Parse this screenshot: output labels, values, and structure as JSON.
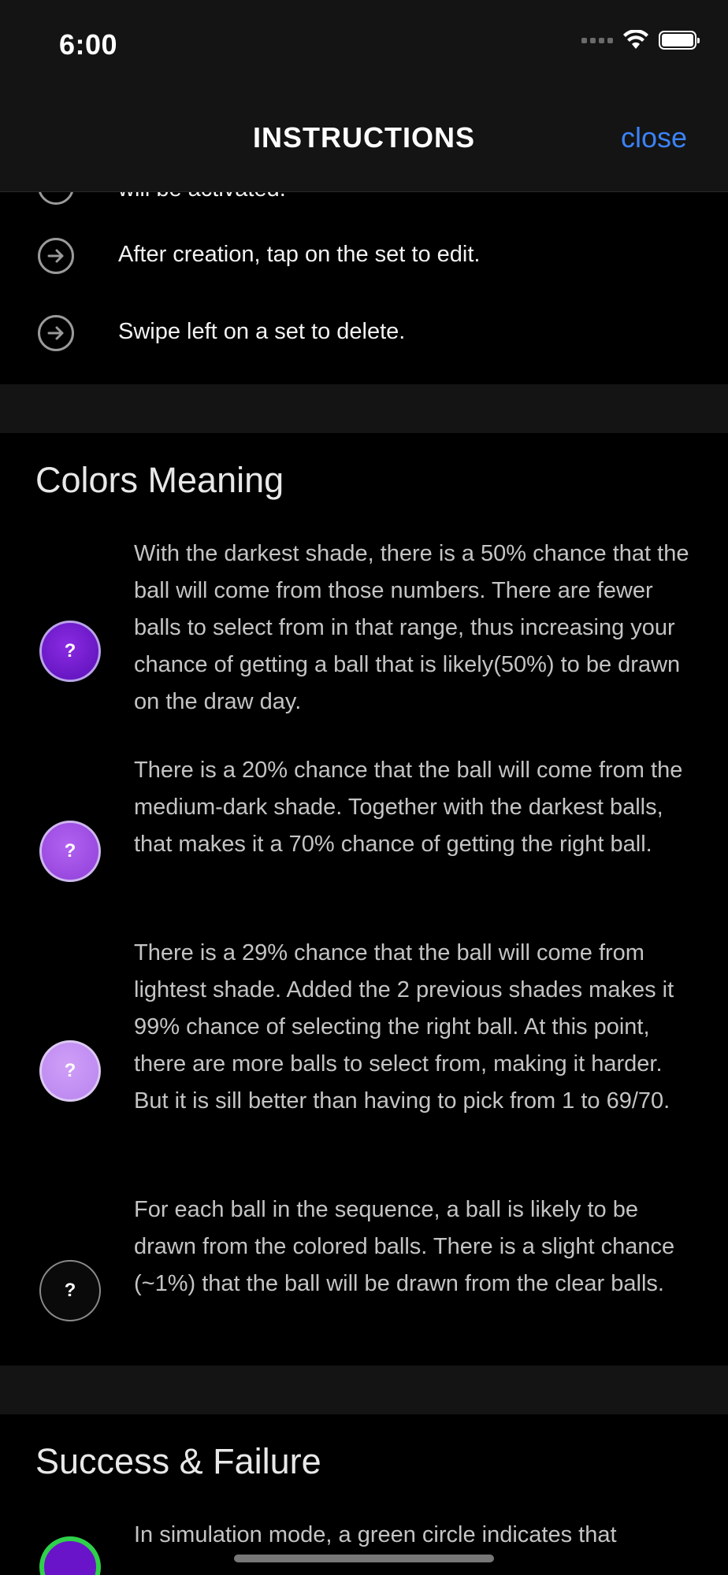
{
  "status_bar": {
    "time": "6:00"
  },
  "nav": {
    "title": "INSTRUCTIONS",
    "close_label": "close"
  },
  "tips": {
    "cut_text": "will be activated.",
    "items": [
      {
        "text": "After creation, tap on the set to edit."
      },
      {
        "text": "Swipe left on a set to delete."
      }
    ]
  },
  "colors_meaning": {
    "title": "Colors Meaning",
    "items": [
      {
        "ball_label": "?",
        "shade": "darkest",
        "color": "#7a1fd6",
        "text": "With the darkest shade, there is a 50% chance that the ball will come from those numbers. There are fewer balls to select from in that range, thus increasing your chance of getting a ball that is likely(50%) to be drawn on the draw day."
      },
      {
        "ball_label": "?",
        "shade": "medium-dark",
        "color": "#a352e6",
        "text": "There is a 20% chance that the ball will come from the medium-dark shade. Together with the darkest balls, that makes it a 70% chance of getting the right ball."
      },
      {
        "ball_label": "?",
        "shade": "lightest",
        "color": "#c596f3",
        "text": "There is a 29% chance that the ball will come from lightest shade. Added the 2 previous shades makes it 99% chance of selecting the right ball. At this point, there are more balls to select from, making it harder. But it is sill better than having to pick from 1 to 69/70."
      },
      {
        "ball_label": "?",
        "shade": "clear",
        "color": "#0a0a0a",
        "text": "For each ball in the sequence, a ball is likely to be drawn from the colored balls. There is a slight chance (~1%) that the ball will be drawn from the clear balls."
      }
    ]
  },
  "success_failure": {
    "title": "Success & Failure",
    "partial_text": "In simulation mode, a green circle indicates that"
  }
}
